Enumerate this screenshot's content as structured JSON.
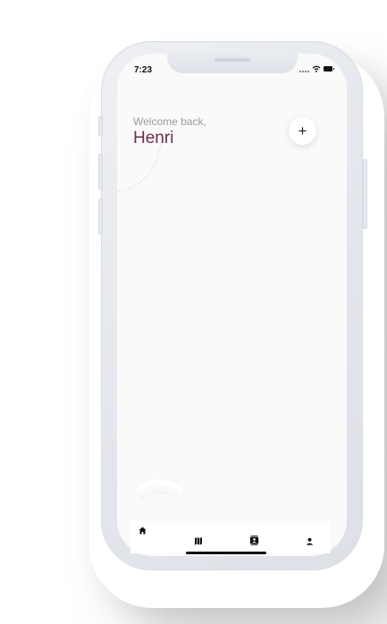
{
  "status_bar": {
    "time": "7:23"
  },
  "header": {
    "greeting": "Welcome back,",
    "user_name": "Henri"
  },
  "actions": {
    "add_label": "+"
  },
  "tab_bar": {
    "tabs": [
      {
        "name": "home",
        "icon": "home-icon",
        "active": true
      },
      {
        "name": "map",
        "icon": "map-icon",
        "active": false
      },
      {
        "name": "contacts",
        "icon": "contacts-icon",
        "active": false
      },
      {
        "name": "profile",
        "icon": "person-icon",
        "active": false
      }
    ]
  },
  "colors": {
    "accent": "#6e2d4f",
    "screen_bg": "#fafafa",
    "frame": "#e3e6ec",
    "muted_text": "#9a9a9a"
  }
}
